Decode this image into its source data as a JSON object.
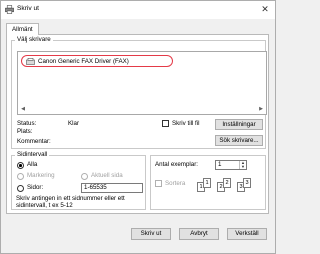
{
  "window": {
    "title": "Skriv ut",
    "close_symbol": "✕"
  },
  "tabs": [
    {
      "label": "Allmänt"
    }
  ],
  "select_printer": {
    "group_label": "Välj skrivare",
    "printers": [
      {
        "name": "Canon Generic FAX Driver (FAX)",
        "selected": true
      }
    ],
    "status_label": "Status:",
    "status_value": "Klar",
    "location_label": "Plats:",
    "location_value": "",
    "comment_label": "Kommentar:",
    "comment_value": "",
    "print_to_file_label": "Skriv till fil",
    "preferences_button": "Inställningar",
    "find_printer_button": "Sök skrivare..."
  },
  "page_range": {
    "group_label": "Sidintervall",
    "all_label": "Alla",
    "selection_label": "Markering",
    "current_page_label": "Aktuell sida",
    "pages_label": "Sidor:",
    "pages_value": "1-65535",
    "hint": "Skriv antingen in ett sidnummer eller ett sidintervall, t ex 5-12",
    "selected": "all"
  },
  "copies": {
    "label": "Antal exemplar:",
    "value": "1",
    "collate_label": "Sortera",
    "collate_checked": false,
    "page_numbers": [
      "1",
      "1",
      "2",
      "2",
      "3",
      "3"
    ]
  },
  "buttons": {
    "print": "Skriv ut",
    "cancel": "Avbryt",
    "apply": "Verkställ"
  },
  "icons": {
    "title_icon": "printer-icon",
    "printer_item_icon": "fax-printer-icon",
    "scroll_left": "◀",
    "scroll_right": "▶",
    "spin_up": "▲",
    "spin_down": "▼"
  },
  "colors": {
    "highlight_ring": "#e43a48",
    "dialog_bg": "#f0f0f0",
    "button_bg": "#e1e1e1"
  }
}
